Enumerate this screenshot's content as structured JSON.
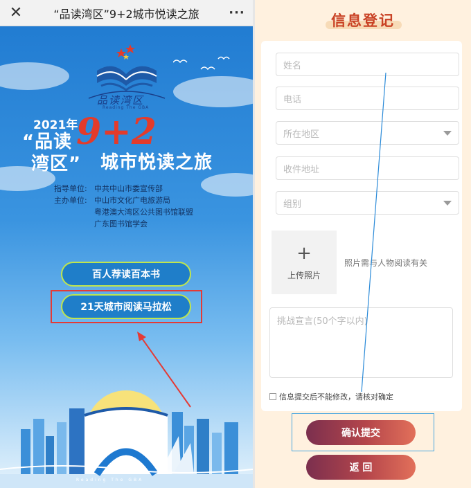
{
  "left": {
    "titlebar": {
      "title": "“品读湾区”9+2城市悦读之旅",
      "close_icon": "close-icon",
      "more_icon": "more-icon"
    },
    "logo": {
      "name": "品读湾区",
      "subtitle": "Reading The GBA"
    },
    "hero": {
      "year": "2021年",
      "line1": "“品读",
      "line2": "湾区”",
      "number": "9+2",
      "line3": "城市悦读之旅"
    },
    "credits": [
      {
        "label": "指导单位:",
        "value": "中共中山市委宣传部"
      },
      {
        "label": "主办单位:",
        "value": "中山市文化广电旅游局"
      },
      {
        "label": "",
        "value": "粤港澳大湾区公共图书馆联盟"
      },
      {
        "label": "",
        "value": "广东图书馆学会"
      }
    ],
    "buttons": {
      "recommend": "百人荐读百本书",
      "marathon": "21天城市阅读马拉松"
    },
    "footer": {
      "text": "Reading The GBA"
    },
    "colors": {
      "accent_red": "#e33b2b",
      "button_blue": "#1f7ec9",
      "button_border": "#bfe54e"
    }
  },
  "right": {
    "title": "信息登记",
    "fields": {
      "name_placeholder": "姓名",
      "phone_placeholder": "电话",
      "region_placeholder": "所在地区",
      "address_placeholder": "收件地址",
      "group_placeholder": "组别"
    },
    "upload": {
      "plus": "+",
      "label": "上传照片",
      "note": "照片需与人物阅读有关"
    },
    "declaration_placeholder": "挑战宣言(50个字以内)",
    "agree_text": "信息提交后不能修改，请核对确定",
    "buttons": {
      "submit": "确认提交",
      "back": "返  回"
    },
    "colors": {
      "title": "#c94124",
      "background": "#fff1df"
    }
  }
}
